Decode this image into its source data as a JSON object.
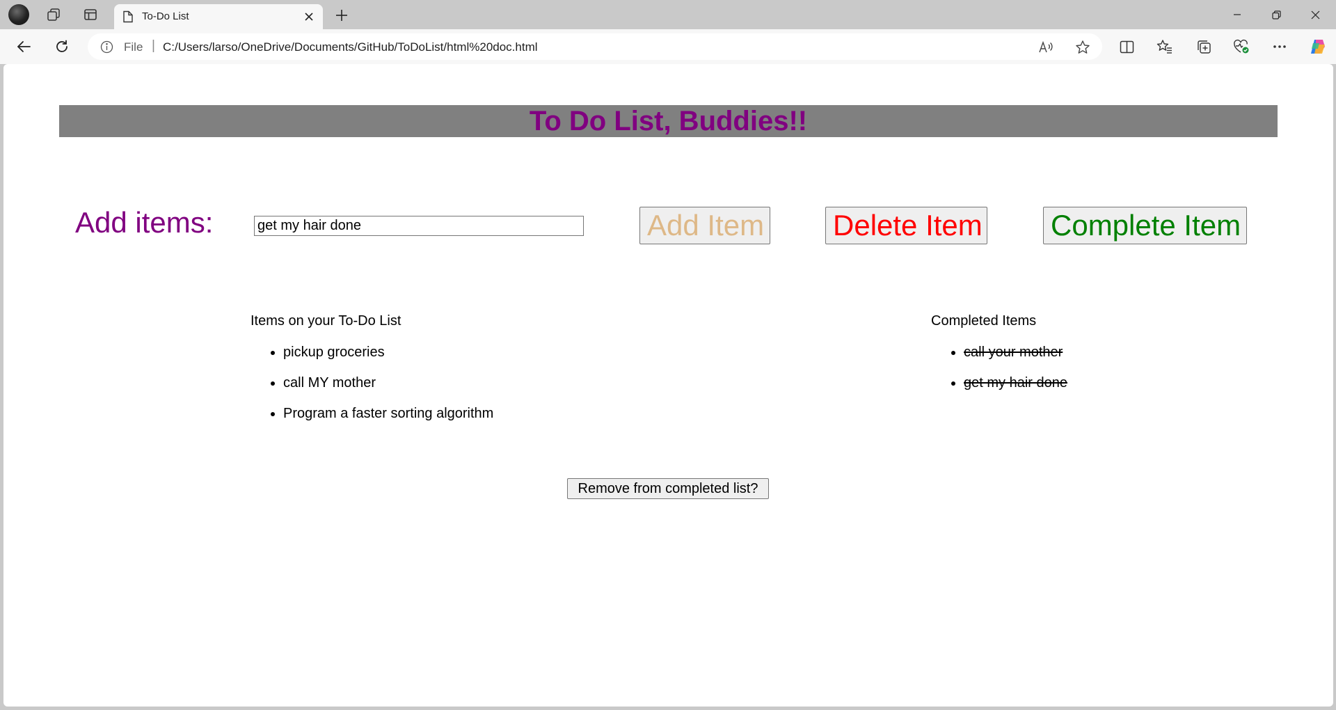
{
  "browser": {
    "tab": {
      "title": "To-Do List"
    },
    "address_bar": {
      "scheme_label": "File",
      "url": "C:/Users/larso/OneDrive/Documents/GitHub/ToDoList/html%20doc.html"
    }
  },
  "page": {
    "header_title": "To Do List, Buddies!!",
    "add_label": "Add items:",
    "input_value": "get my hair done",
    "buttons": {
      "add": "Add Item",
      "delete": "Delete Item",
      "complete": "Complete Item",
      "remove_completed": "Remove from completed list?"
    },
    "todo_heading": "Items on your To-Do List",
    "todo_items": [
      "pickup groceries",
      "call MY mother",
      "Program a faster sorting algorithm"
    ],
    "completed_heading": "Completed Items",
    "completed_items": [
      "call your mother",
      "get my hair done"
    ]
  },
  "colors": {
    "header_background": "#808080",
    "header_text": "#800080",
    "add_label": "#800080",
    "add_button_text": "#deb887",
    "delete_button_text": "#ff0000",
    "complete_button_text": "#008000"
  }
}
